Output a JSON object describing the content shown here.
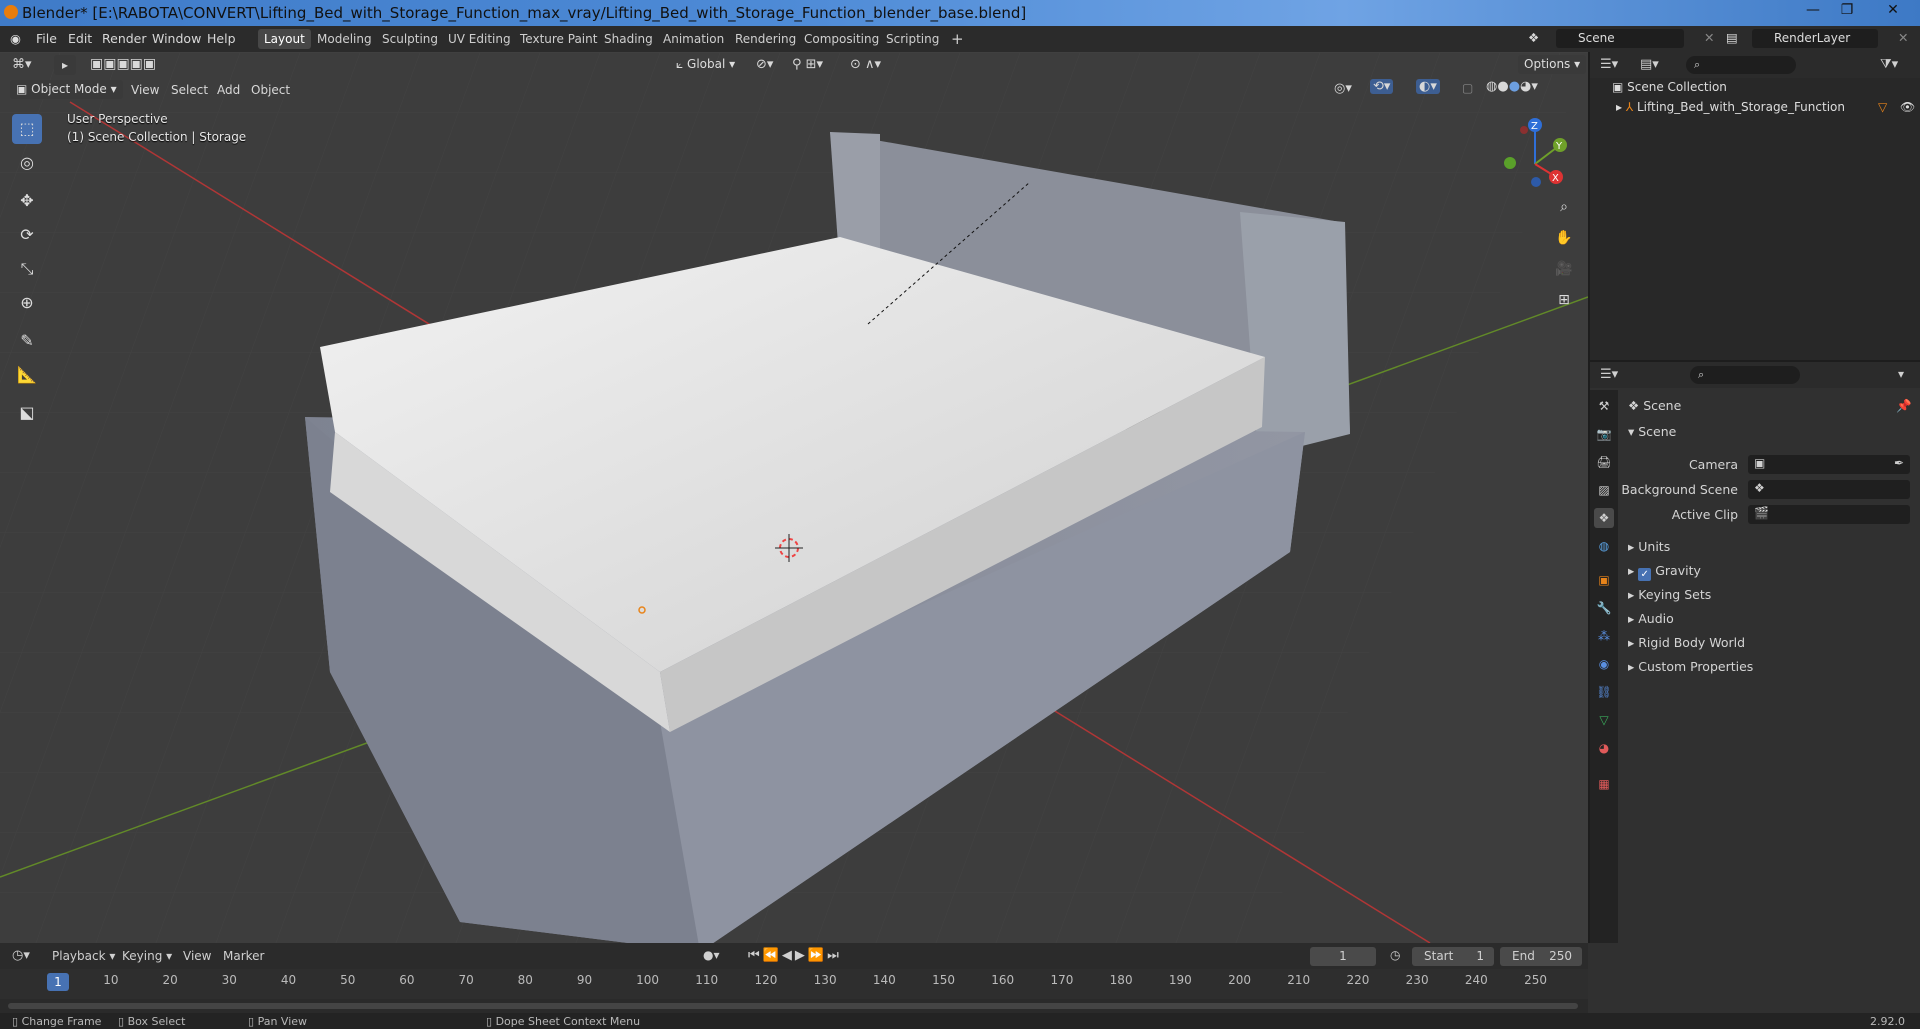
{
  "window": {
    "title": "Blender* [E:\\RABOTA\\CONVERT\\Lifting_Bed_with_Storage_Function_max_vray/Lifting_Bed_with_Storage_Function_blender_base.blend]"
  },
  "menu": [
    "File",
    "Edit",
    "Render",
    "Window",
    "Help"
  ],
  "workspaces": [
    "Layout",
    "Modeling",
    "Sculpting",
    "UV Editing",
    "Texture Paint",
    "Shading",
    "Animation",
    "Rendering",
    "Compositing",
    "Scripting"
  ],
  "active_workspace": "Layout",
  "scene_field": "Scene",
  "renderlayer_field": "RenderLayer",
  "viewport": {
    "mode": "Object Mode",
    "menus": [
      "View",
      "Select",
      "Add",
      "Object"
    ],
    "transform_orientation": "Global",
    "options_label": "Options",
    "perspective_label": "User Perspective",
    "collection_label": "(1) Scene Collection | Storage",
    "gizmo_axes": [
      "X",
      "Y",
      "Z"
    ]
  },
  "outliner": {
    "root": "Scene Collection",
    "items": [
      {
        "label": "Lifting_Bed_with_Storage_Function"
      }
    ]
  },
  "properties": {
    "breadcrumb": "Scene",
    "panel_title": "Scene",
    "fields": [
      {
        "label": "Camera"
      },
      {
        "label": "Background Scene"
      },
      {
        "label": "Active Clip"
      }
    ],
    "sections": [
      "Units",
      "Gravity",
      "Keying Sets",
      "Audio",
      "Rigid Body World",
      "Custom Properties"
    ],
    "gravity_checked": true
  },
  "timeline": {
    "menus": [
      "Playback",
      "Keying",
      "View",
      "Marker"
    ],
    "current_frame": "1",
    "start_label": "Start",
    "start_value": "1",
    "end_label": "End",
    "end_value": "250",
    "ruler_marks": [
      "10",
      "20",
      "30",
      "40",
      "50",
      "60",
      "70",
      "80",
      "90",
      "100",
      "110",
      "120",
      "130",
      "140",
      "150",
      "160",
      "170",
      "180",
      "190",
      "200",
      "210",
      "220",
      "230",
      "240",
      "250"
    ],
    "playhead": "1"
  },
  "statusbar": {
    "items": [
      "Change Frame",
      "Box Select",
      "Pan View",
      "Dope Sheet Context Menu"
    ],
    "version": "2.92.0"
  },
  "colors": {
    "accent": "#4772b3",
    "viewport_bg": "#3d3d3d",
    "x_axis": "#c23a3a",
    "y_axis": "#6a9a2a"
  }
}
